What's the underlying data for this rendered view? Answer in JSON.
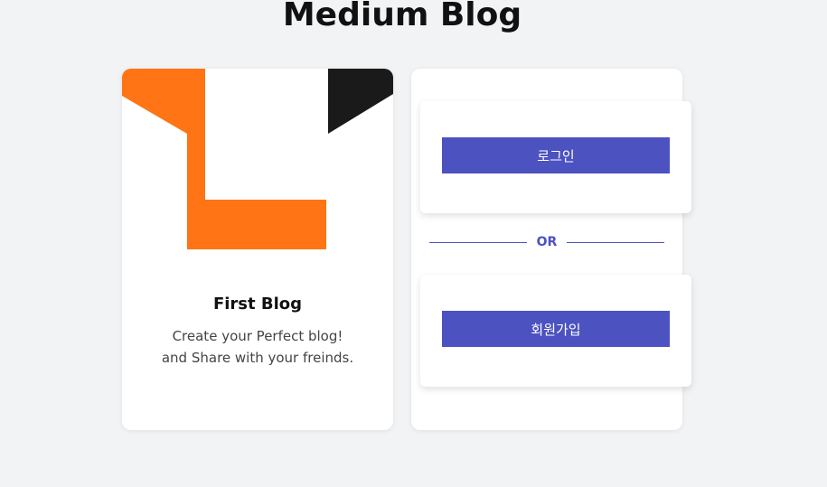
{
  "page": {
    "title": "Medium Blog"
  },
  "blog_card": {
    "logo": "orange-L-logo",
    "title": "First Blog",
    "description_line1": "Create your Perfect blog!",
    "description_line2": "and Share with your freinds."
  },
  "auth_card": {
    "login_label": "로그인",
    "divider_label": "OR",
    "signup_label": "회원가입"
  },
  "colors": {
    "background": "#f2f3f5",
    "accent": "#4c52c0",
    "logo_orange": "#ff7414",
    "logo_dark": "#1a1a1a"
  }
}
